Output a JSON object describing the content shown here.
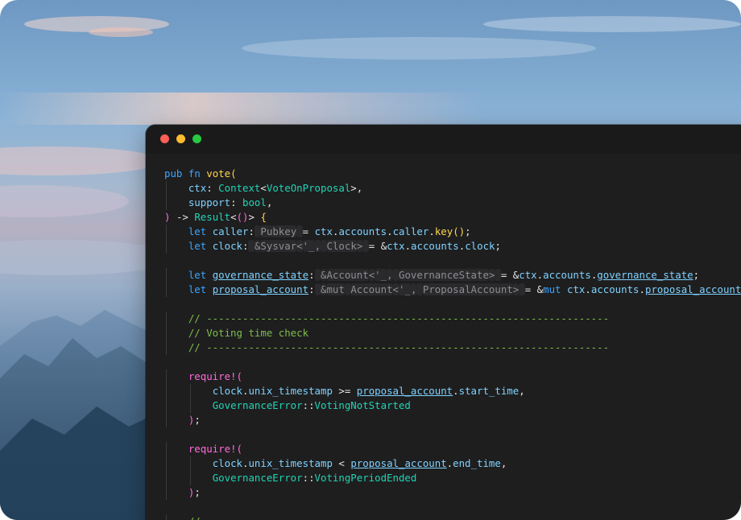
{
  "window": {
    "controls": [
      "close",
      "minimize",
      "zoom"
    ]
  },
  "code": {
    "language": "rust",
    "lines": [
      "pub fn vote(",
      "    ctx: Context<VoteOnProposal>,",
      "    support: bool,",
      ") -> Result<()> {",
      "    let caller: Pubkey = ctx.accounts.caller.key();",
      "    let clock: &Sysvar<'_, Clock> = &ctx.accounts.clock;",
      "",
      "    let governance_state: &Account<'_, GovernanceState> = &ctx.accounts.governance_state;",
      "    let proposal_account: &mut Account<'_, ProposalAccount> = &mut ctx.accounts.proposal_account;",
      "",
      "    // -------------------------------------------------------------------",
      "    // Voting time check",
      "    // -------------------------------------------------------------------",
      "",
      "    require!(",
      "        clock.unix_timestamp >= proposal_account.start_time,",
      "        GovernanceError::VotingNotStarted",
      "    );",
      "",
      "    require!(",
      "        clock.unix_timestamp < proposal_account.end_time,",
      "        GovernanceError::VotingPeriodEnded",
      "    );",
      "",
      "    //"
    ]
  }
}
